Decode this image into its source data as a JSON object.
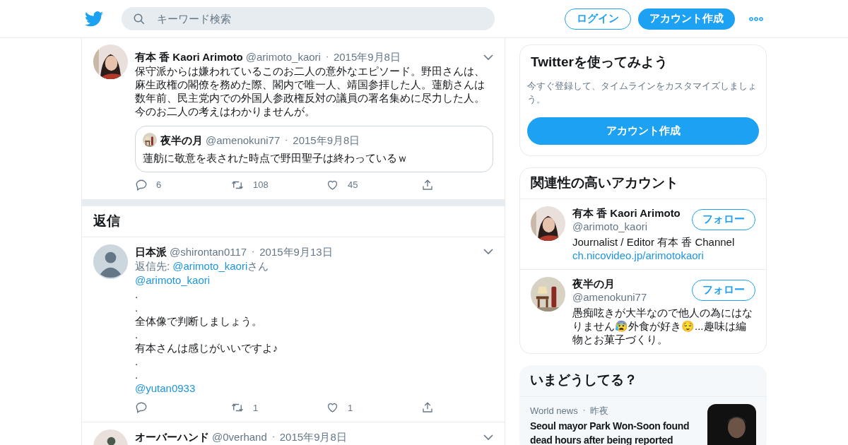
{
  "header": {
    "search": {
      "placeholder": "キーワード検索"
    },
    "login": "ログイン",
    "signup": "アカウント作成"
  },
  "main_tweet": {
    "name": "有本 香 Kaori Arimoto",
    "handle": "@arimoto_kaori",
    "sep": "・",
    "date": "2015年9月8日",
    "text": "保守派からは嫌われているこのお二人の意外なエピソード。野田さんは、麻生政権の閣僚を務めた際、閣内で唯一人、靖国参拝した人。蓮舫さんは数年前、民主党内での外国人参政権反対の議員の署名集めに尽力した人。今のお二人の考えはわかりませんが。",
    "quote": {
      "name": "夜半の月",
      "handle": "@amenokuni77",
      "sep": "・",
      "date": "2015年9月8日",
      "text": "蓮舫に敬意を表された時点で野田聖子は終わっているｗ"
    },
    "replies": "6",
    "retweets": "108",
    "likes": "45"
  },
  "replies_heading": "返信",
  "replies": [
    {
      "kind": "default",
      "name": "日本派",
      "handle": "@shirontan0117",
      "sep": "・",
      "date": "2015年9月13日",
      "reply_label": "返信先:",
      "reply_handle": "@arimoto_kaori",
      "reply_suffix": "さん",
      "lines": [
        {
          "kind": "link",
          "text": "@arimoto_kaori"
        },
        {
          "kind": "text",
          "text": "."
        },
        {
          "kind": "text",
          "text": "."
        },
        {
          "kind": "text",
          "text": "全体像で判断しましょう。"
        },
        {
          "kind": "text",
          "text": "."
        },
        {
          "kind": "text",
          "text": "有本さんは感じがいいですよ♪"
        },
        {
          "kind": "text",
          "text": "."
        },
        {
          "kind": "text",
          "text": "."
        },
        {
          "kind": "link",
          "text": "@yutan0933"
        }
      ],
      "retweets": "1",
      "likes": "1"
    },
    {
      "kind": "picture",
      "name": "オーバーハンド",
      "handle": "@0verhand",
      "sep": "・",
      "date": "2015年9月8日"
    }
  ],
  "sidebar": {
    "signup_card": {
      "title": "Twitterを使ってみよう",
      "text": "今すぐ登録して、タイムラインをカスタマイズしましょう。",
      "button": "アカウント作成"
    },
    "related": {
      "title": "関連性の高いアカウント",
      "accounts": [
        {
          "name": "有本 香 Kaori Arimoto",
          "handle": "@arimoto_kaori",
          "bio": "Journalist / Editor 有本 香 Channel",
          "link": "ch.nicovideo.jp/arimotokaori",
          "follow": "フォロー"
        },
        {
          "name": "夜半の月",
          "handle": "@amenokuni77",
          "bio": "愚痴呟きが大半なので他人の為にはなりません😰外食が好き😌...趣味は編物とお菓子づくり。",
          "follow": "フォロー"
        }
      ]
    },
    "trends": {
      "title": "いまどうしてる？",
      "items": [
        {
          "category": "World news",
          "sep": "・",
          "time": "昨夜",
          "headline": "Seoul mayor Park Won-Soon found dead hours after being reported"
        }
      ]
    }
  }
}
